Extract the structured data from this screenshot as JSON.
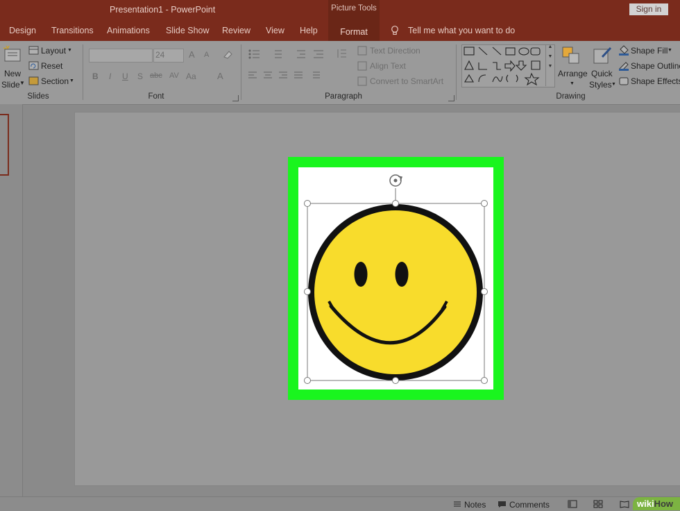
{
  "window": {
    "title": "Presentation1  -  PowerPoint",
    "context_tab_group": "Picture Tools",
    "sign_in": "Sign in"
  },
  "tabs": [
    "Design",
    "Transitions",
    "Animations",
    "Slide Show",
    "Review",
    "View",
    "Help"
  ],
  "active_tab": "Format",
  "tell_me": "Tell me what you want to do",
  "ribbon": {
    "slides": {
      "new_slide_line1": "New",
      "new_slide_line2": "Slide",
      "layout": "Layout",
      "reset": "Reset",
      "section": "Section",
      "label": "Slides"
    },
    "font": {
      "font_size": "24",
      "label": "Font",
      "bold": "B",
      "italic": "I",
      "underline": "U",
      "shadow": "S",
      "strike": "abc",
      "spacing": "AV",
      "case": "Aa",
      "color": "A",
      "grow": "A",
      "shrink": "A"
    },
    "paragraph": {
      "text_direction": "Text Direction",
      "align_text": "Align Text",
      "convert_smartart": "Convert to SmartArt",
      "label": "Paragraph"
    },
    "drawing": {
      "arrange": "Arrange",
      "quick_styles_line1": "Quick",
      "quick_styles_line2": "Styles",
      "shape_fill": "Shape Fill",
      "shape_outline": "Shape Outline",
      "shape_effects": "Shape Effects",
      "label": "Drawing"
    }
  },
  "status": {
    "notes": "Notes",
    "comments": "Comments"
  },
  "watermark": {
    "brand_a": "wiki",
    "brand_b": "How"
  },
  "colors": {
    "title_bar": "#7a2b1c",
    "selection_border": "#19f51e",
    "smiley_yellow": "#f8dc2c"
  },
  "slide_content": {
    "image": "smiley-face",
    "selected": true
  }
}
